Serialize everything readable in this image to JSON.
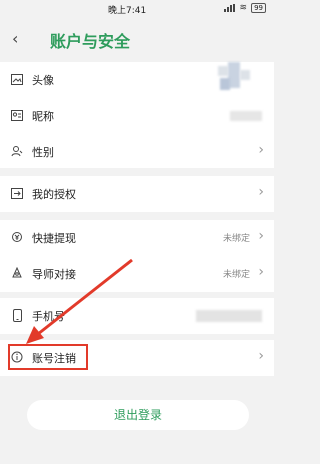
{
  "status_bar": {
    "time": "晚上7:41",
    "battery": "99"
  },
  "header": {
    "back_icon": "chevron-left-icon",
    "title": "账户与安全"
  },
  "rows": [
    {
      "label": "头像",
      "icon": "image-icon"
    },
    {
      "label": "昵称",
      "icon": "id-card-icon"
    },
    {
      "label": "性别",
      "icon": "person-icon"
    },
    {
      "label": "我的授权",
      "icon": "authorize-icon"
    },
    {
      "label": "快捷提现",
      "icon": "withdraw-icon",
      "value": "未绑定"
    },
    {
      "label": "导师对接",
      "icon": "mentor-icon",
      "value": "未绑定"
    },
    {
      "label": "手机号",
      "icon": "phone-icon"
    },
    {
      "label": "账号注销",
      "icon": "info-icon"
    }
  ],
  "logout_button": {
    "label": "退出登录"
  },
  "colors": {
    "accent": "#2e9c5c",
    "annotation": "#e23a2a"
  }
}
